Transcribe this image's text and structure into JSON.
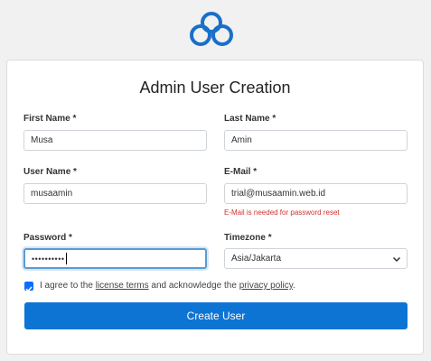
{
  "logo": {
    "icon": "cloud-icon",
    "color": "#1a6fc9"
  },
  "form": {
    "title": "Admin User Creation",
    "first_name": {
      "label": "First Name *",
      "value": "Musa"
    },
    "last_name": {
      "label": "Last Name *",
      "value": "Amin"
    },
    "user_name": {
      "label": "User Name *",
      "value": "musaamin"
    },
    "email": {
      "label": "E-Mail *",
      "value": "trial@musaamin.web.id",
      "hint": "E-Mail is needed for password reset"
    },
    "password": {
      "label": "Password *",
      "value": "••••••••••"
    },
    "timezone": {
      "label": "Timezone *",
      "value": "Asia/Jakarta"
    },
    "agree": {
      "checked": true,
      "text_before": "I agree to the",
      "license_link": "license terms",
      "text_middle": "and acknowledge the",
      "privacy_link": "privacy policy",
      "text_after": "."
    },
    "submit_label": "Create User"
  },
  "colors": {
    "primary": "#0d74d4",
    "error": "#d0312d",
    "focus": "#5b9bd5"
  }
}
